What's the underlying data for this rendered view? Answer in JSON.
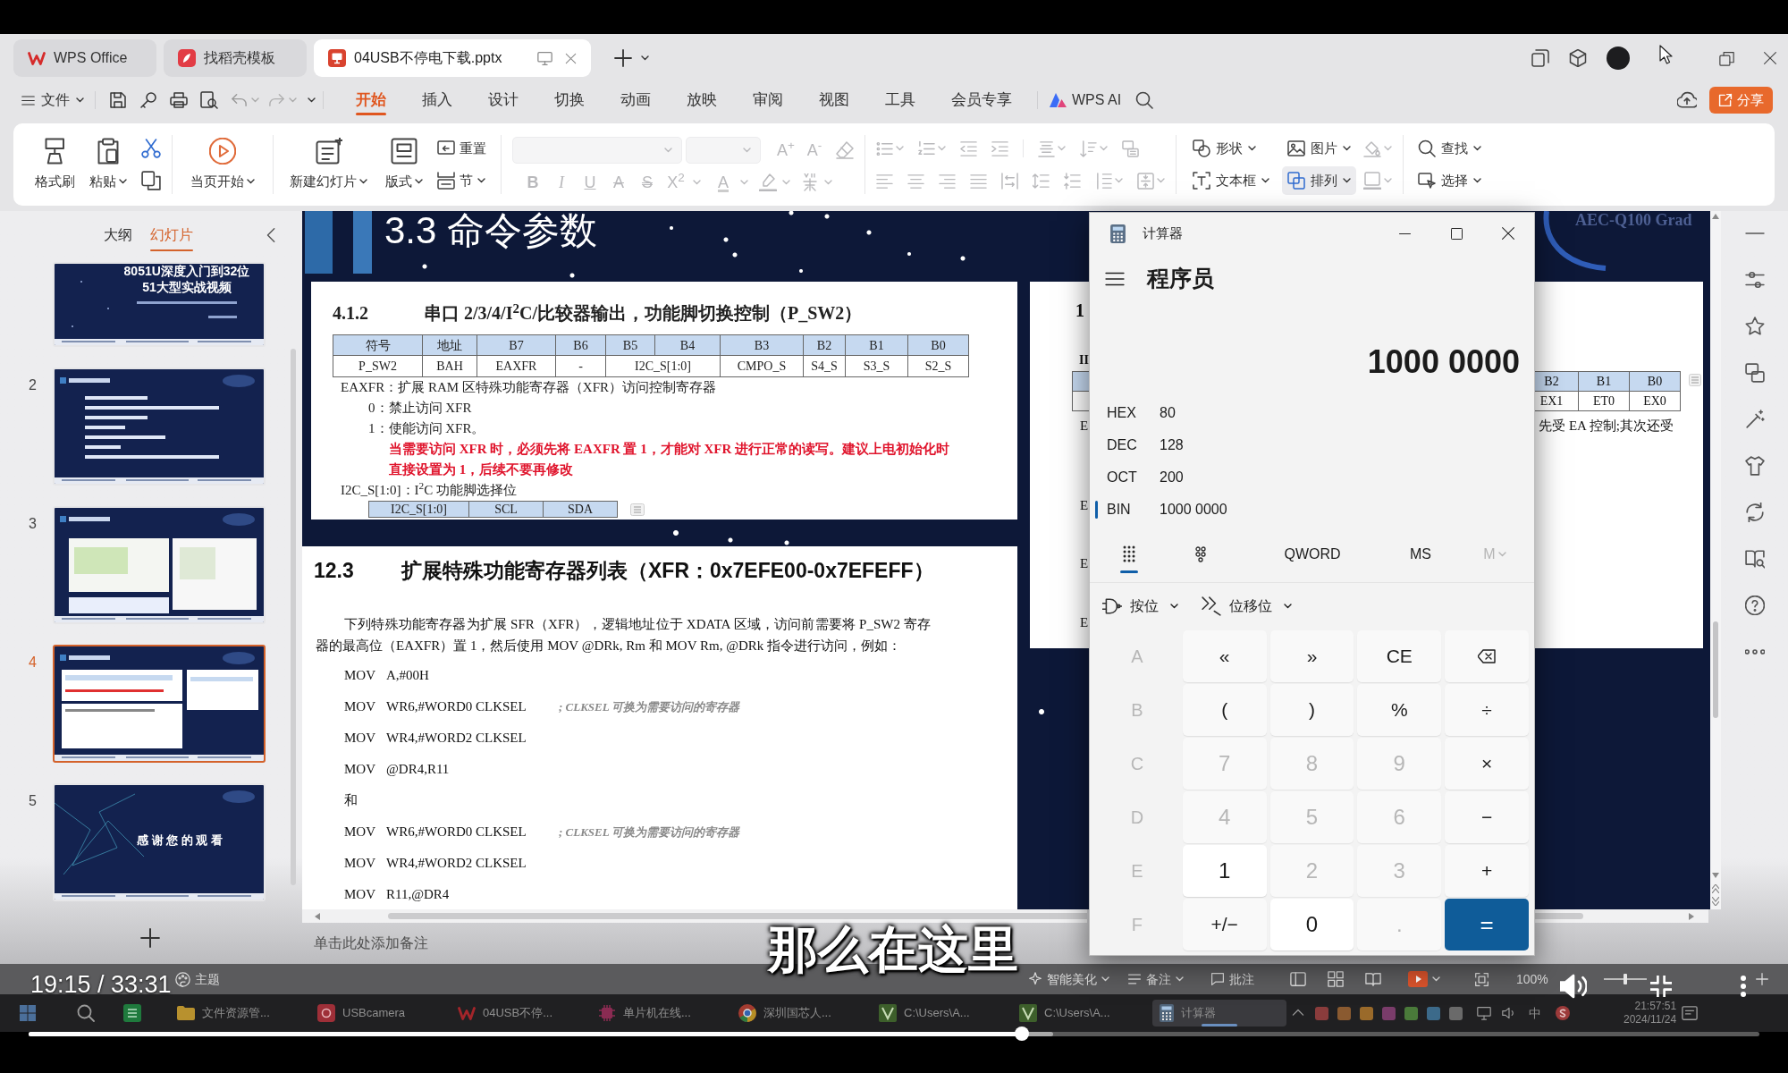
{
  "window_tabs": [
    {
      "kind": "wps",
      "label": "WPS Office",
      "selected": false
    },
    {
      "kind": "template",
      "label": "找稻壳模板",
      "selected": false
    },
    {
      "kind": "presentation",
      "label": "04USB不停电下载.pptx",
      "selected": true
    }
  ],
  "menu": {
    "file": "文件",
    "tabs": [
      {
        "label": "开始",
        "selected": true
      },
      {
        "label": "插入",
        "selected": false
      },
      {
        "label": "设计",
        "selected": false
      },
      {
        "label": "切换",
        "selected": false
      },
      {
        "label": "动画",
        "selected": false
      },
      {
        "label": "放映",
        "selected": false
      },
      {
        "label": "审阅",
        "selected": false
      },
      {
        "label": "视图",
        "selected": false
      },
      {
        "label": "工具",
        "selected": false
      },
      {
        "label": "会员专享",
        "selected": false
      }
    ],
    "ai": "WPS AI",
    "share": "分享"
  },
  "ribbon": {
    "clipboard": [
      {
        "kind": "format_painter",
        "label": "格式刷"
      },
      {
        "kind": "paste",
        "label": "粘贴"
      }
    ],
    "play": "当页开始",
    "new_slide": "新建幻灯片",
    "layout": "版式",
    "reset": "重置",
    "section": "节",
    "font_size_up": "A$^{+}$",
    "font_size_down": "A$^{-}$",
    "format": [
      {
        "kind": "bold",
        "label": "B"
      },
      {
        "kind": "italic",
        "label": "I"
      },
      {
        "kind": "underline",
        "label": "U"
      },
      {
        "kind": "strike",
        "label": "A"
      },
      {
        "kind": "shadow",
        "label": "S"
      },
      {
        "kind": "superscript",
        "label": "X$^{2}$"
      },
      {
        "kind": "color",
        "label": "A"
      }
    ],
    "insert": [
      {
        "kind": "shape",
        "label": "形状",
        "hovered": false
      },
      {
        "kind": "picture",
        "label": "图片",
        "hovered": false
      },
      {
        "kind": "textbox",
        "label": "文本框",
        "hovered": false
      },
      {
        "kind": "arrange",
        "label": "排列",
        "hovered": true
      }
    ],
    "find": "查找",
    "select": "选择"
  },
  "slide_panel": {
    "tabs": [
      {
        "label": "大纲",
        "selected": false
      },
      {
        "label": "幻灯片",
        "selected": true
      }
    ],
    "slides": [
      {
        "kind": "cover",
        "title": "8051U深度入门到32位",
        "subtitle": "51大型实战视频",
        "selected": false
      },
      {
        "kind": "list",
        "number": "2",
        "selected": false
      },
      {
        "kind": "screens",
        "number": "3",
        "selected": false
      },
      {
        "kind": "docs",
        "number": "4",
        "selected": true
      },
      {
        "kind": "ending",
        "number": "5",
        "title": "感 谢 您 的 观 看",
        "selected": false
      }
    ]
  },
  "slide": {
    "title": "3.3 命令参数",
    "corner_text": "AEC-Q100 Grad",
    "doc_a": {
      "number": "4.1.2",
      "heading": "串口 2/3/4/I$^{2}$C/比较器输出，功能脚切换控制（P_SW2）",
      "header": [
        "符号",
        "地址",
        "B7",
        "B6",
        "B5",
        "B4",
        "B3",
        "B2",
        "B1",
        "B0"
      ],
      "row": [
        {
          "text": "P_SW2",
          "wide": false
        },
        {
          "text": "BAH",
          "wide": false
        },
        {
          "text": "EAXFR",
          "wide": false
        },
        {
          "text": "-",
          "wide": false
        },
        {
          "text": "I2C_S[1:0]",
          "wide": true
        },
        {
          "text": "CMPO_S",
          "wide": false
        },
        {
          "text": "S4_S",
          "wide": false
        },
        {
          "text": "S3_S",
          "wide": false
        },
        {
          "text": "S2_S",
          "wide": false
        }
      ],
      "lines": [
        {
          "kind": "label",
          "text": "EAXFR：扩展 RAM 区特殊功能寄存器（XFR）访问控制寄存器"
        },
        {
          "kind": "option",
          "text": "0：禁止访问 XFR"
        },
        {
          "kind": "option",
          "text": "1：使能访问 XFR。"
        },
        {
          "kind": "warning",
          "text": "当需要访问 XFR 时，必须先将 EAXFR 置 1，才能对 XFR 进行正常的读写。建议上电初始化时直接设置为 1，后续不要再修改"
        },
        {
          "kind": "label",
          "text": "I2C_S[1:0]：I$^{2}$C 功能脚选择位"
        }
      ],
      "subtable": [
        "I2C_S[1:0]",
        "SCL",
        "SDA"
      ]
    },
    "doc_b": {
      "number": "12.3",
      "heading": "扩展特殊功能寄存器列表（XFR：0x7EFE00-0x7EFEFF）",
      "paragraph": "下列特殊功能寄存器为扩展 SFR（XFR），逻辑地址位于 XDATA 区域，访问前需要将 P_SW2 寄存器的最高位（EAXFR）置 1，然后使用 MOV @DRk, Rm 和 MOV Rm, @DRk 指令进行访问，例如：",
      "code": [
        {
          "kind": "code",
          "op": "MOV",
          "arg": "A,#00H"
        },
        {
          "kind": "code",
          "op": "MOV",
          "arg": "WR6,#WORD0 CLKSEL",
          "comment": "; CLKSEL 可换为需要访问的寄存器"
        },
        {
          "kind": "code",
          "op": "MOV",
          "arg": "WR4,#WORD2 CLKSEL"
        },
        {
          "kind": "code",
          "op": "MOV",
          "arg": "@DR4,R11"
        },
        {
          "kind": "text",
          "text": "和"
        },
        {
          "kind": "code",
          "op": "MOV",
          "arg": "WR6,#WORD0 CLKSEL",
          "comment": "; CLKSEL 可换为需要访问的寄存器"
        },
        {
          "kind": "code",
          "op": "MOV",
          "arg": "WR4,#WORD2 CLKSEL"
        },
        {
          "kind": "code",
          "op": "MOV",
          "arg": "R11,@DR4"
        }
      ]
    },
    "doc_c": {
      "heading": "1",
      "label": "II",
      "header": [
        "B2",
        "B1",
        "B0"
      ],
      "row": [
        "EX1",
        "ET0",
        "EX0"
      ],
      "text": "先受 EA 控制;其次还受",
      "line_starts": [
        "E",
        "E",
        "E",
        "E"
      ]
    }
  },
  "calculator": {
    "title": "计算器",
    "mode": "程序员",
    "display": "1000 0000",
    "radix": [
      {
        "label": "HEX",
        "value": "80",
        "selected": false
      },
      {
        "label": "DEC",
        "value": "128",
        "selected": false
      },
      {
        "label": "OCT",
        "value": "200",
        "selected": false
      },
      {
        "label": "BIN",
        "value": "1000 0000",
        "selected": true
      }
    ],
    "keypad_modes": [
      {
        "kind": "full_keypad",
        "selected": true
      },
      {
        "kind": "bit_toggling",
        "selected": false
      }
    ],
    "word_size": "QWORD",
    "memory": [
      {
        "label": "MS",
        "disabled": false,
        "dropdown": false
      },
      {
        "label": "M",
        "disabled": true,
        "dropdown": true
      }
    ],
    "menus": [
      {
        "kind": "bitwise",
        "label": "按位"
      },
      {
        "kind": "bit_shift",
        "label": "位移位"
      }
    ],
    "keys": [
      {
        "label": "A",
        "kind": "hex",
        "disabled": true
      },
      {
        "label": "«",
        "kind": "operator",
        "disabled": false
      },
      {
        "label": "»",
        "kind": "operator",
        "disabled": false
      },
      {
        "label": "CE",
        "kind": "operator",
        "disabled": false
      },
      {
        "kind": "backspace",
        "disabled": false
      },
      {
        "label": "B",
        "kind": "hex",
        "disabled": true
      },
      {
        "label": "(",
        "kind": "operator",
        "disabled": false
      },
      {
        "label": ")",
        "kind": "operator",
        "disabled": false
      },
      {
        "label": "%",
        "kind": "operator",
        "disabled": false
      },
      {
        "label": "÷",
        "kind": "operator",
        "disabled": false
      },
      {
        "label": "C",
        "kind": "hex",
        "disabled": true
      },
      {
        "label": "7",
        "kind": "digit",
        "disabled": true
      },
      {
        "label": "8",
        "kind": "digit",
        "disabled": true
      },
      {
        "label": "9",
        "kind": "digit",
        "disabled": true
      },
      {
        "label": "×",
        "kind": "operator",
        "disabled": false
      },
      {
        "label": "D",
        "kind": "hex",
        "disabled": true
      },
      {
        "label": "4",
        "kind": "digit",
        "disabled": true
      },
      {
        "label": "5",
        "kind": "digit",
        "disabled": true
      },
      {
        "label": "6",
        "kind": "digit",
        "disabled": true
      },
      {
        "label": "−",
        "kind": "operator",
        "disabled": false
      },
      {
        "label": "E",
        "kind": "hex",
        "disabled": true
      },
      {
        "label": "1",
        "kind": "digit",
        "disabled": false
      },
      {
        "label": "2",
        "kind": "digit",
        "disabled": true
      },
      {
        "label": "3",
        "kind": "digit",
        "disabled": true
      },
      {
        "label": "+",
        "kind": "operator",
        "disabled": false
      },
      {
        "label": "F",
        "kind": "hex",
        "disabled": true
      },
      {
        "label": "+/−",
        "kind": "operator",
        "disabled": false
      },
      {
        "label": "0",
        "kind": "digit",
        "disabled": false
      },
      {
        "label": ".",
        "kind": "digit",
        "disabled": true
      },
      {
        "label": "=",
        "kind": "equals",
        "disabled": false
      }
    ]
  },
  "notes": {
    "placeholder": "单击此处添加备注"
  },
  "status_bar": {
    "theme": "主题",
    "beautify": "智能美化",
    "notes": "备注",
    "comments": "批注",
    "zoom": "100%",
    "zoom_slider": {
      "level": 0.5
    }
  },
  "taskbar": {
    "items": [
      {
        "kind": "sheet",
        "selected": false
      },
      {
        "kind": "folder",
        "label": "文件资源管...",
        "selected": false
      },
      {
        "kind": "camera",
        "label": "USBcamera",
        "selected": false
      },
      {
        "kind": "wps",
        "label": "04USB不停...",
        "selected": false
      },
      {
        "kind": "chip",
        "label": "单片机在线...",
        "selected": false
      },
      {
        "kind": "browser",
        "label": "深圳国芯人...",
        "selected": false
      },
      {
        "kind": "ide",
        "label": "C:\\Users\\A...",
        "selected": false
      },
      {
        "kind": "ide",
        "label": "C:\\Users\\A...",
        "selected": false
      },
      {
        "kind": "calculator",
        "label": "计算器",
        "selected": true
      }
    ],
    "ime": "中",
    "clock": "21:57:51",
    "date": "2024/11/24"
  },
  "video_player": {
    "subtitle": "那么在这里",
    "time": "19:15 / 33:31",
    "progress": {
      "level": 0.574
    },
    "buffer": {
      "level": 0.592
    }
  }
}
